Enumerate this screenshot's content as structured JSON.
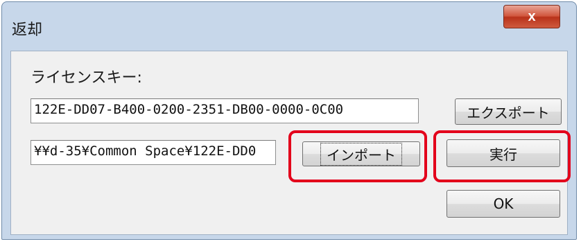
{
  "window": {
    "title": "返却",
    "close_label": "x"
  },
  "license": {
    "label": "ライセンスキー:",
    "key_value": "122E-DD07-B400-0200-2351-DB00-0000-0C00",
    "path_value": "¥¥d-35¥Common Space¥122E-DD0"
  },
  "buttons": {
    "export": "エクスポート",
    "import": "インポート",
    "execute": "実行",
    "ok": "OK"
  },
  "annotation": {
    "highlight_color": "#e3001b"
  }
}
